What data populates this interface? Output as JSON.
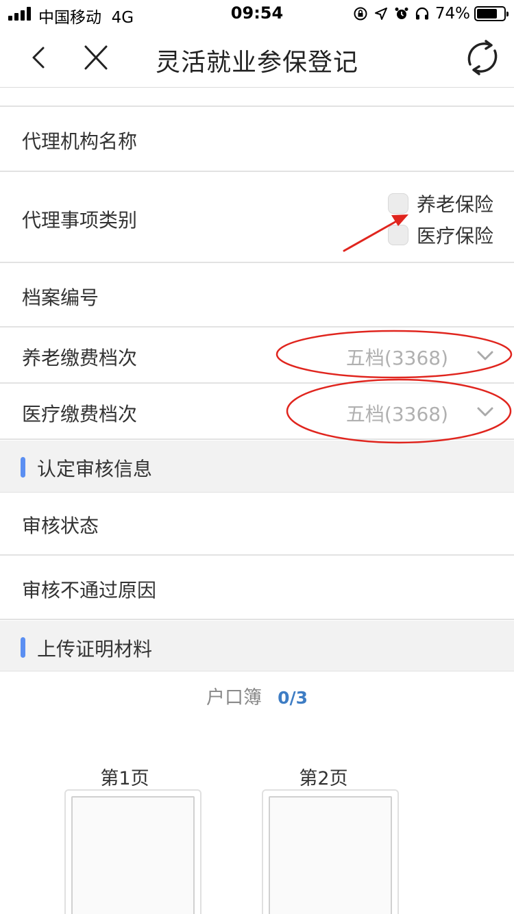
{
  "status_bar": {
    "carrier": "中国移动",
    "network": "4G",
    "time": "09:54",
    "battery": "74%",
    "icons": [
      "signal-icon",
      "lock-rotation-icon",
      "location-icon",
      "alarm-icon",
      "headphones-icon",
      "battery-icon"
    ]
  },
  "nav": {
    "title": "灵活就业参保登记",
    "back_icon": "chevron-left-icon",
    "close_icon": "close-icon",
    "refresh_icon": "refresh-icon"
  },
  "form": {
    "agency_name_label": "代理机构名称",
    "agency_type_label": "代理事项类别",
    "agency_type_options": [
      "养老保险",
      "医疗保险"
    ],
    "archive_no_label": "档案编号",
    "pension_level_label": "养老缴费档次",
    "pension_level_value": "五档(3368)",
    "medical_level_label": "医疗缴费档次",
    "medical_level_value": "五档(3368)"
  },
  "review": {
    "section_title": "认定审核信息",
    "status_label": "审核状态",
    "reject_reason_label": "审核不通过原因"
  },
  "upload": {
    "section_title": "上传证明材料",
    "doc_name": "户口簿",
    "doc_count": "0/3",
    "pages": [
      "第1页",
      "第2页"
    ]
  },
  "colors": {
    "accent_bar": "#5b8ff2",
    "count_text": "#3e7dc4",
    "annotation_red": "#e0251e"
  }
}
